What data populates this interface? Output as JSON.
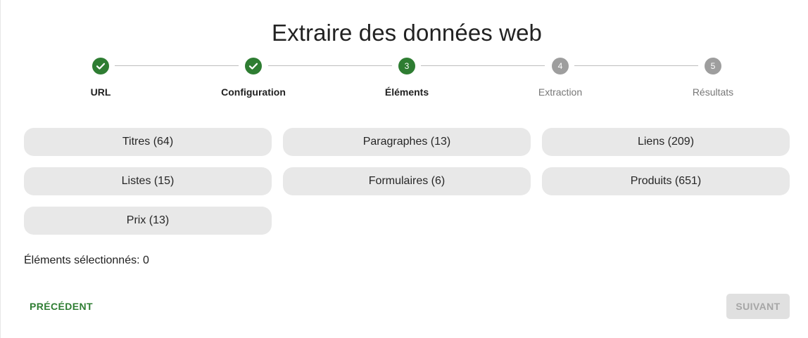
{
  "page": {
    "title": "Extraire des données web"
  },
  "stepper": {
    "steps": [
      {
        "label": "URL",
        "state": "done",
        "number": "1"
      },
      {
        "label": "Configuration",
        "state": "done",
        "number": "2"
      },
      {
        "label": "Éléments",
        "state": "active",
        "number": "3"
      },
      {
        "label": "Extraction",
        "state": "pending",
        "number": "4"
      },
      {
        "label": "Résultats",
        "state": "pending",
        "number": "5"
      }
    ],
    "colors": {
      "done": "#2e7d32",
      "active": "#2e7d32",
      "pending": "#9e9e9e"
    }
  },
  "elements": {
    "chips": [
      {
        "label": "Titres (64)"
      },
      {
        "label": "Paragraphes (13)"
      },
      {
        "label": "Liens (209)"
      },
      {
        "label": "Listes (15)"
      },
      {
        "label": "Formulaires (6)"
      },
      {
        "label": "Produits (651)"
      },
      {
        "label": "Prix (13)"
      }
    ],
    "selected_text": "Éléments sélectionnés: 0"
  },
  "actions": {
    "previous_label": "PRÉCÉDENT",
    "next_label": "SUIVANT",
    "next_disabled": true
  }
}
